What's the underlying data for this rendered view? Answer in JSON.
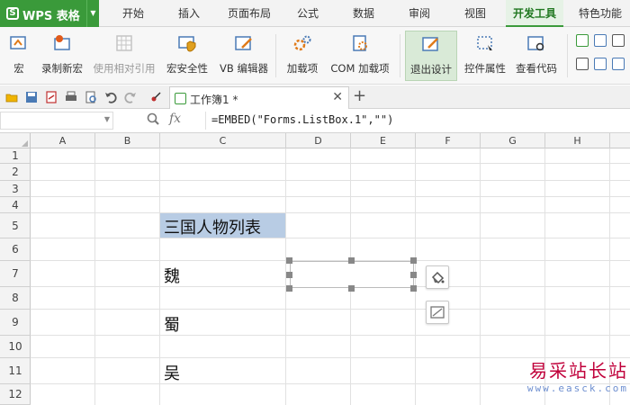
{
  "app": {
    "name": "WPS 表格",
    "logo": "S"
  },
  "menu_tabs": [
    {
      "label": "开始"
    },
    {
      "label": "插入"
    },
    {
      "label": "页面布局"
    },
    {
      "label": "公式"
    },
    {
      "label": "数据"
    },
    {
      "label": "审阅"
    },
    {
      "label": "视图"
    },
    {
      "label": "开发工具",
      "active": true
    },
    {
      "label": "特色功能"
    }
  ],
  "ribbon": {
    "macro": "宏",
    "record_macro": "录制新宏",
    "relative_ref": "使用相对引用",
    "macro_security": "宏安全性",
    "vb_editor": "VB 编辑器",
    "addins": "加载项",
    "com_addins": "COM 加载项",
    "exit_design": "退出设计",
    "control_props": "控件属性",
    "view_code": "查看代码"
  },
  "document": {
    "tab_name": "工作簿1 *"
  },
  "formula_bar": {
    "name_box": "",
    "fx": "fx",
    "formula": "=EMBED(\"Forms.ListBox.1\",\"\")"
  },
  "grid": {
    "columns": [
      "A",
      "B",
      "C",
      "D",
      "E",
      "F",
      "G",
      "H"
    ],
    "rows": [
      "1",
      "2",
      "3",
      "4",
      "5",
      "6",
      "7",
      "8",
      "9",
      "10",
      "11",
      "12"
    ],
    "cells": {
      "c5": "三国人物列表",
      "c7": "魏",
      "c9": "蜀",
      "c11": "吴"
    },
    "title_fill": "#b8cce4"
  },
  "watermark": {
    "line1": "易采站长站",
    "line2": "www.easck.com"
  },
  "colors": {
    "brand_green": "#3a9a3a",
    "active_tab": "#217821",
    "ribbon_bg": "#f7f7f7"
  }
}
